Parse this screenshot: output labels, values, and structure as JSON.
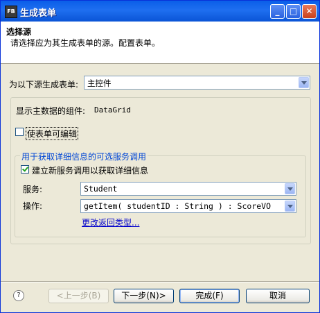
{
  "window": {
    "app_icon": "FB",
    "title": "生成表单",
    "min_glyph": "_",
    "max_glyph": "□",
    "close_glyph": "✕"
  },
  "header": {
    "title": "选择源",
    "description": "请选择应为其生成表单的源。配置表单。"
  },
  "source": {
    "label": "为以下源生成表单:",
    "value": "主控件"
  },
  "master": {
    "label": "显示主数据的组件:",
    "value": "DataGrid"
  },
  "editable": {
    "label": "使表单可编辑",
    "checked": false
  },
  "detail_section": {
    "title": "用于获取详细信息的可选服务调用",
    "create_new_label": "建立新服务调用以获取详细信息",
    "create_new_checked": true,
    "service_label": "服务:",
    "service_value": "Student",
    "operation_label": "操作:",
    "operation_value": "getItem( studentID : String ) : ScoreVO",
    "change_return_type_link": "更改返回类型..."
  },
  "footer": {
    "help_glyph": "?",
    "back_label": "<上一步(B)",
    "next_label": "下一步(N)>",
    "finish_label": "完成(F)",
    "cancel_label": "取消"
  }
}
